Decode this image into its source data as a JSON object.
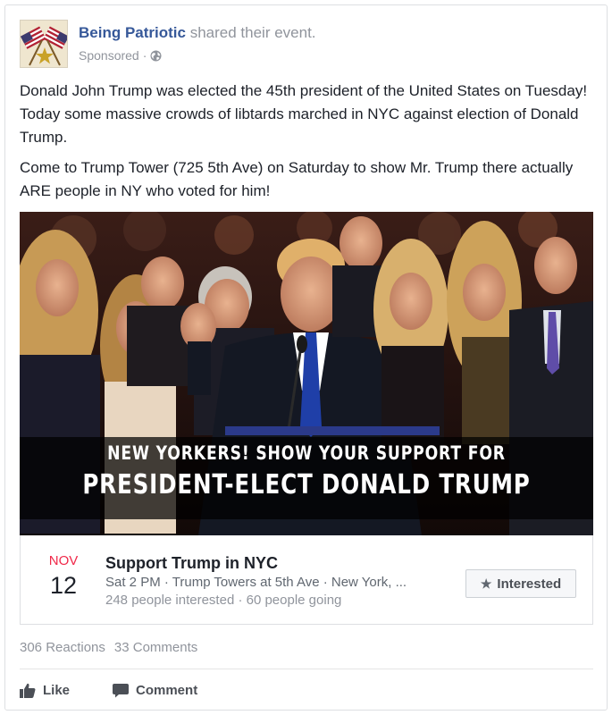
{
  "post": {
    "page_name": "Being Patriotic",
    "shared_text": "shared their",
    "event_link": "event.",
    "sponsored": "Sponsored",
    "meta_sep": "·",
    "body_p1": "Donald John Trump was elected the 45th president of the United States on Tuesday! Today some massive crowds of libtards marched in NYC against election of Donald Trump.",
    "body_p2": "Come to Trump Tower (725 5th Ave) on Saturday to show Mr. Trump there actually ARE people in NY who voted for him!"
  },
  "media": {
    "overlay_line1": "NEW YORKERS! SHOW YOUR SUPPORT FOR",
    "overlay_line2": "PRESIDENT-ELECT DONALD TRUMP"
  },
  "event": {
    "month": "NOV",
    "day": "12",
    "title": "Support Trump in NYC",
    "details": "Sat 2 PM · Trump Towers at 5th Ave · New York, ...",
    "stats": "248 people interested · 60 people going",
    "interested_label": "Interested"
  },
  "footer": {
    "reactions": "306 Reactions",
    "comments": "33 Comments",
    "like_label": "Like",
    "comment_label": "Comment"
  },
  "colors": {
    "link_blue": "#365899",
    "month_red": "#f02849",
    "muted_gray": "#90949c"
  },
  "icons": [
    "flags-avatar",
    "globe-icon",
    "star-icon",
    "thumbs-up-icon",
    "comment-icon"
  ]
}
